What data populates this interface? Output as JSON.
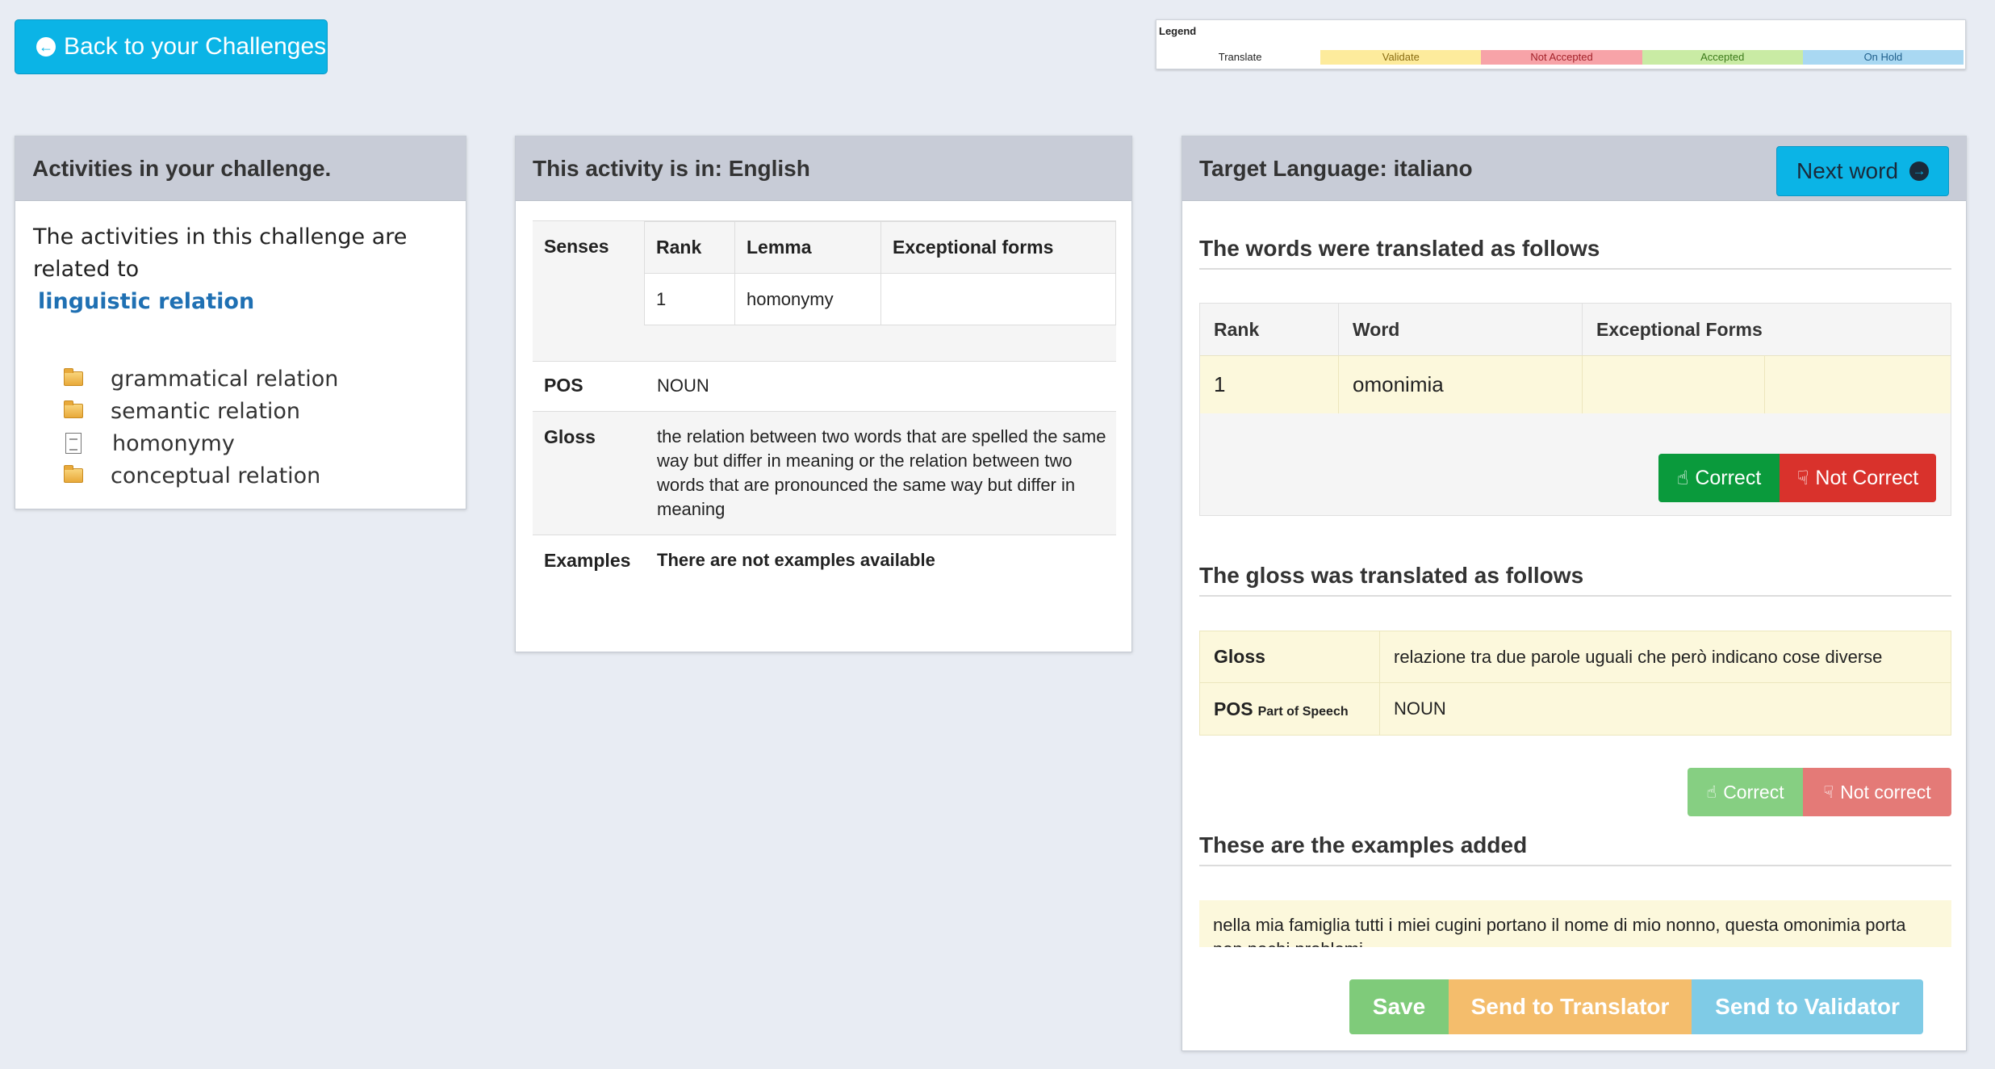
{
  "back_button": {
    "label": "Back to your Challenges"
  },
  "legend": {
    "title": "Legend",
    "items": [
      {
        "label": "Translate",
        "color": "#ffffff",
        "text_color": "#222222"
      },
      {
        "label": "Validate",
        "color": "#fdeb9c",
        "text_color": "#8a6d12"
      },
      {
        "label": "Not Accepted",
        "color": "#f7a3a8",
        "text_color": "#a3222a"
      },
      {
        "label": "Accepted",
        "color": "#c9eba4",
        "text_color": "#3c7a1a"
      },
      {
        "label": "On Hold",
        "color": "#a9d8f2",
        "text_color": "#1f5f8c"
      }
    ]
  },
  "activities_panel": {
    "title": "Activities in your challenge.",
    "intro": "The activities in this challenge are related to",
    "related_link": "linguistic relation",
    "items": [
      {
        "label": "grammatical relation",
        "icon": "folder-icon"
      },
      {
        "label": "semantic relation",
        "icon": "folder-icon"
      },
      {
        "label": "homonymy",
        "icon": "document-icon"
      },
      {
        "label": "conceptual relation",
        "icon": "folder-icon"
      }
    ]
  },
  "source_panel": {
    "title": "This activity is in: English",
    "senses_label": "Senses",
    "columns": [
      "Rank",
      "Lemma",
      "Exceptional forms"
    ],
    "row": {
      "rank": "1",
      "lemma": "homonymy",
      "exceptional": ""
    },
    "pos_label": "POS",
    "pos_value": "NOUN",
    "gloss_label": "Gloss",
    "gloss_value": "the relation between two words that are spelled the same way but differ in meaning or the relation between two words that are pronounced the same way but differ in meaning",
    "examples_label": "Examples",
    "examples_value": "There are not examples available"
  },
  "target_panel": {
    "title": "Target Language: italiano",
    "next_word": "Next word",
    "words_heading": "The words were translated as follows",
    "columns": [
      "Rank",
      "Word",
      "Exceptional Forms"
    ],
    "row": {
      "rank": "1",
      "word": "omonimia",
      "exceptional": ""
    },
    "correct_label": "Correct",
    "not_correct_label": "Not Correct",
    "gloss_heading": "The gloss was translated as follows",
    "gloss_label": "Gloss",
    "gloss_value": "relazione tra due parole uguali che però indicano cose diverse",
    "pos_label": "POS",
    "pos_sub": "Part of Speech",
    "pos_value": "NOUN",
    "gloss_correct_label": "Correct",
    "gloss_not_correct_label": "Not correct",
    "examples_heading": "These are the examples added",
    "example_text": "nella mia famiglia tutti i miei cugini portano il nome di mio nonno, questa omonimia porta non pochi problemi",
    "save_label": "Save",
    "send_translator_label": "Send to Translator",
    "send_validator_label": "Send to Validator"
  },
  "colors": {
    "accent": "#0bb4e6",
    "correct_green": "#0a9a3c",
    "not_correct_red": "#d9322c",
    "save_green": "#7fcb7a",
    "translator_orange": "#f4bd6c",
    "validator_blue": "#7fcbe6",
    "highlight_yellow": "#fcf8dc"
  }
}
